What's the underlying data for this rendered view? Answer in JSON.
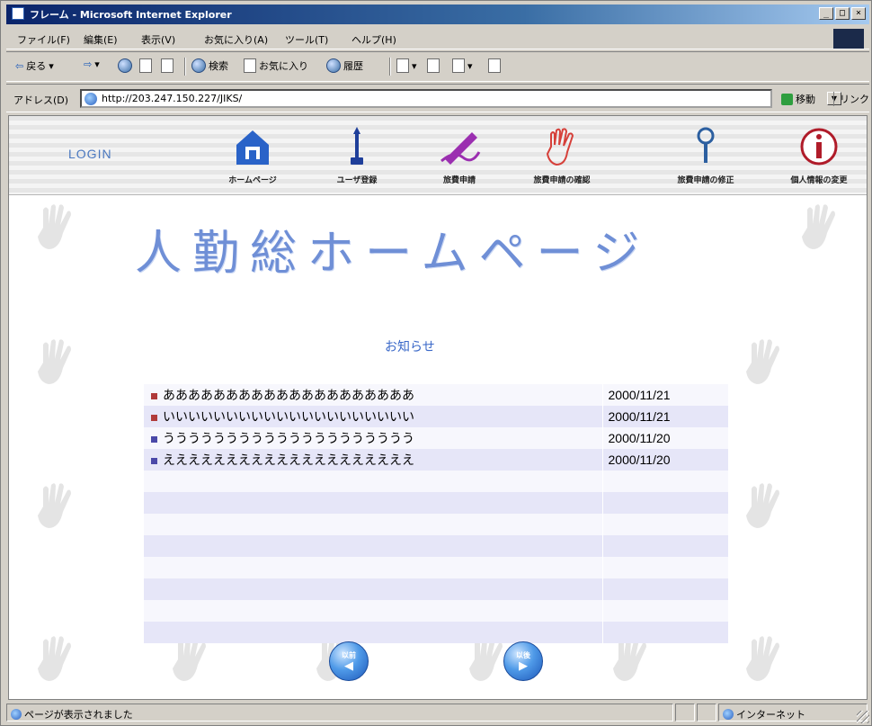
{
  "window": {
    "title": "フレーム - Microsoft Internet Explorer",
    "controls": [
      "_",
      "□",
      "×"
    ]
  },
  "menubar": {
    "items": [
      "ファイル(F)",
      "編集(E)",
      "表示(V)",
      "お気に入り(A)",
      "ツール(T)",
      "ヘルプ(H)"
    ]
  },
  "toolbar": {
    "back": "戻る",
    "search": "検索",
    "favorites": "お気に入り",
    "history": "履歴"
  },
  "addressbar": {
    "label": "アドレス(D)",
    "url": "http://203.247.150.227/JIKS/",
    "go": "移動",
    "links": "リンク »"
  },
  "nav": {
    "login": "LOGIN",
    "items": [
      {
        "label": "ホームページ",
        "icon": "home-icon",
        "color": "#2a63c8"
      },
      {
        "label": "ユーザ登録",
        "icon": "user-register-icon",
        "color": "#1f3f9a"
      },
      {
        "label": "旅費申請",
        "icon": "pen-icon",
        "color": "#9b2fb0"
      },
      {
        "label": "旅費申請の確認",
        "icon": "hand-icon",
        "color": "#d6403a"
      },
      {
        "label": "旅費申請の修正",
        "icon": "magnifier-icon",
        "color": "#2c5fa0"
      },
      {
        "label": "個人情報の変更",
        "icon": "info-icon",
        "color": "#b01c2a"
      }
    ]
  },
  "main": {
    "heading": "人勤総ホームページ",
    "notice_title": "お知らせ",
    "notices": [
      {
        "title": "ああああああああああああああああああああ",
        "date": "2000/11/21",
        "bullet": "red"
      },
      {
        "title": "いいいいいいいいいいいいいいいいいいいい",
        "date": "2000/11/21",
        "bullet": "red"
      },
      {
        "title": "うううううううううううううううううううう",
        "date": "2000/11/20",
        "bullet": "blue"
      },
      {
        "title": "ええええええええええええええええええええ",
        "date": "2000/11/20",
        "bullet": "blue"
      },
      {
        "title": "",
        "date": "",
        "bullet": ""
      },
      {
        "title": "",
        "date": "",
        "bullet": ""
      },
      {
        "title": "",
        "date": "",
        "bullet": ""
      },
      {
        "title": "",
        "date": "",
        "bullet": ""
      },
      {
        "title": "",
        "date": "",
        "bullet": ""
      },
      {
        "title": "",
        "date": "",
        "bullet": ""
      },
      {
        "title": "",
        "date": "",
        "bullet": ""
      },
      {
        "title": "",
        "date": "",
        "bullet": ""
      }
    ],
    "prev_label": "以前",
    "next_label": "以後"
  },
  "statusbar": {
    "message": "ページが表示されました",
    "zone": "インターネット"
  },
  "colors": {
    "highlight": "#e0252a",
    "heading": "#6f8fd6",
    "accent": "#3a68c8"
  }
}
